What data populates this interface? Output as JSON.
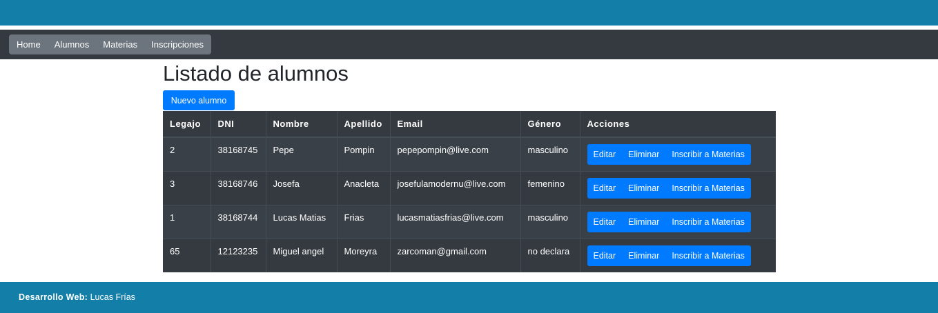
{
  "nav": {
    "items": [
      {
        "label": "Home"
      },
      {
        "label": "Alumnos"
      },
      {
        "label": "Materias"
      },
      {
        "label": "Inscripciones"
      }
    ]
  },
  "page": {
    "title": "Listado de alumnos",
    "new_button": "Nuevo alumno"
  },
  "table": {
    "headers": [
      "Legajo",
      "DNI",
      "Nombre",
      "Apellido",
      "Email",
      "Género",
      "Acciones"
    ],
    "rows": [
      {
        "legajo": "2",
        "dni": "38168745",
        "nombre": "Pepe",
        "apellido": "Pompin",
        "email": "pepepompin@live.com",
        "genero": "masculino"
      },
      {
        "legajo": "3",
        "dni": "38168746",
        "nombre": "Josefa",
        "apellido": "Anacleta",
        "email": "josefulamodernu@live.com",
        "genero": "femenino"
      },
      {
        "legajo": "1",
        "dni": "38168744",
        "nombre": "Lucas Matias",
        "apellido": "Frias",
        "email": "lucasmatiasfrias@live.com",
        "genero": "masculino"
      },
      {
        "legajo": "65",
        "dni": "12123235",
        "nombre": "Miguel angel",
        "apellido": "Moreyra",
        "email": "zarcoman@gmail.com",
        "genero": "no declara"
      }
    ],
    "actions": {
      "edit": "Editar",
      "delete": "Eliminar",
      "enroll": "Inscribir a Materias"
    }
  },
  "footer": {
    "label": "Desarrollo Web:",
    "author": "Lucas Frías"
  },
  "colors": {
    "header_bar": "#137ea8",
    "navbar": "#343a40",
    "primary": "#007bff"
  }
}
